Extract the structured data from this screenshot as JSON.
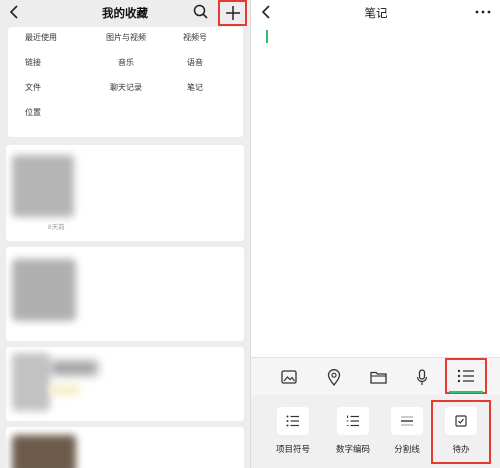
{
  "favorites": {
    "title": "我的收藏",
    "categories": {
      "row1": [
        "最近使用",
        "图片与视频",
        "视频号"
      ],
      "row2": [
        "链接",
        "音乐",
        "语音"
      ],
      "row3": [
        "文件",
        "聊天记录",
        "笔记"
      ],
      "row4": [
        "位置"
      ]
    },
    "items": [
      {
        "time": "8天前"
      }
    ]
  },
  "note": {
    "title": "笔记",
    "toolbar_icons": [
      "image-icon",
      "location-pin-icon",
      "folder-icon",
      "microphone-icon",
      "list-format-icon"
    ],
    "formats": [
      {
        "label": "项目符号",
        "icon": "bullet-list-icon"
      },
      {
        "label": "数字编码",
        "icon": "numbered-list-icon"
      },
      {
        "label": "分割线",
        "icon": "divider-icon"
      },
      {
        "label": "待办",
        "icon": "checkbox-icon"
      }
    ]
  },
  "colors": {
    "highlight": "#e53a2f",
    "accent": "#2fbf71"
  }
}
